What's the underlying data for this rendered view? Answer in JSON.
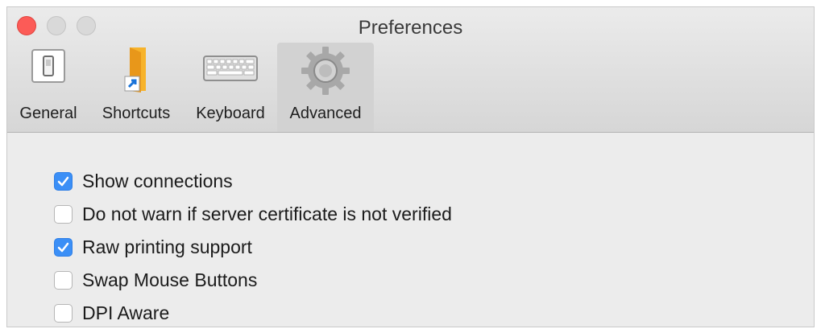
{
  "window": {
    "title": "Preferences"
  },
  "tabs": [
    {
      "label": "General",
      "icon": "general-switch-icon",
      "selected": false
    },
    {
      "label": "Shortcuts",
      "icon": "folder-shortcut-icon",
      "selected": false
    },
    {
      "label": "Keyboard",
      "icon": "keyboard-icon",
      "selected": false
    },
    {
      "label": "Advanced",
      "icon": "gear-icon",
      "selected": true
    }
  ],
  "options": [
    {
      "label": "Show connections",
      "checked": true
    },
    {
      "label": "Do not warn if server certificate is not verified",
      "checked": false
    },
    {
      "label": "Raw printing support",
      "checked": true
    },
    {
      "label": "Swap Mouse Buttons",
      "checked": false
    },
    {
      "label": "DPI Aware",
      "checked": false
    }
  ],
  "colors": {
    "accent": "#3b8ff6",
    "close": "#fc5b57",
    "window_bg": "#ececec"
  }
}
